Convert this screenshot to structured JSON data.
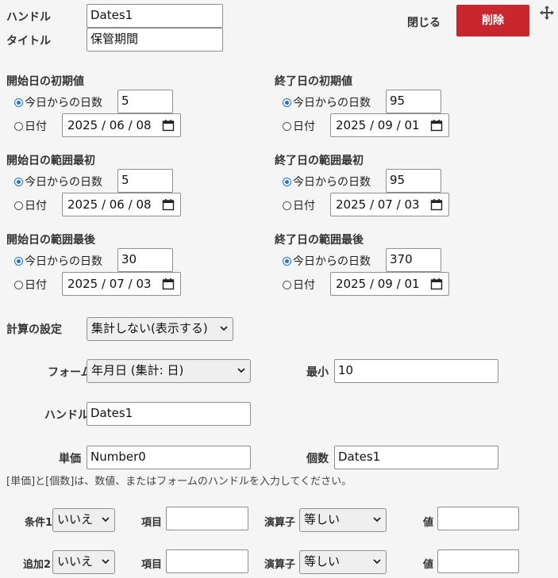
{
  "header": {
    "handle_label": "ハンドル",
    "handle_value": "Dates1",
    "title_label": "タイトル",
    "title_value": "保管期間",
    "close_label": "閉じる",
    "delete_label": "削除",
    "move_icon": "move-arrows-icon"
  },
  "radio_labels": {
    "days": "今日からの日数",
    "date": "日付"
  },
  "blocks": {
    "start_initial": {
      "title": "開始日の初期値",
      "days": "5",
      "date": "2025 / 06 / 08",
      "selected": "days"
    },
    "end_initial": {
      "title": "終了日の初期値",
      "days": "95",
      "date": "2025 / 09 / 01",
      "selected": "days"
    },
    "start_range_first": {
      "title": "開始日の範囲最初",
      "days": "5",
      "date": "2025 / 06 / 08",
      "selected": "days"
    },
    "end_range_first": {
      "title": "終了日の範囲最初",
      "days": "95",
      "date": "2025 / 07 / 03",
      "selected": "days"
    },
    "start_range_last": {
      "title": "開始日の範囲最後",
      "days": "30",
      "date": "2025 / 07 / 03",
      "selected": "days"
    },
    "end_range_last": {
      "title": "終了日の範囲最後",
      "days": "370",
      "date": "2025 / 09 / 01",
      "selected": "days"
    }
  },
  "calc": {
    "label": "計算の設定",
    "value": "集計しない(表示する)"
  },
  "form": {
    "form_label": "フォーム",
    "form_value": "年月日 (集計: 日)",
    "min_label": "最小",
    "min_value": "10",
    "handle_label": "ハンドル",
    "handle_value": "Dates1",
    "unit_price_label": "単価",
    "unit_price_value": "Number0",
    "count_label": "個数",
    "count_value": "Dates1",
    "hint": "[単価]と[個数]は、数値、またはフォームのハンドルを入力してください。"
  },
  "conditions": [
    {
      "label": "条件1",
      "choice": "いいえ",
      "item_label": "項目",
      "item_value": "",
      "op_label": "演算子",
      "op_value": "等しい",
      "val_label": "値",
      "val_value": ""
    },
    {
      "label": "追加2",
      "choice": "いいえ",
      "item_label": "項目",
      "item_value": "",
      "op_label": "演算子",
      "op_value": "等しい",
      "val_label": "値",
      "val_value": ""
    }
  ]
}
